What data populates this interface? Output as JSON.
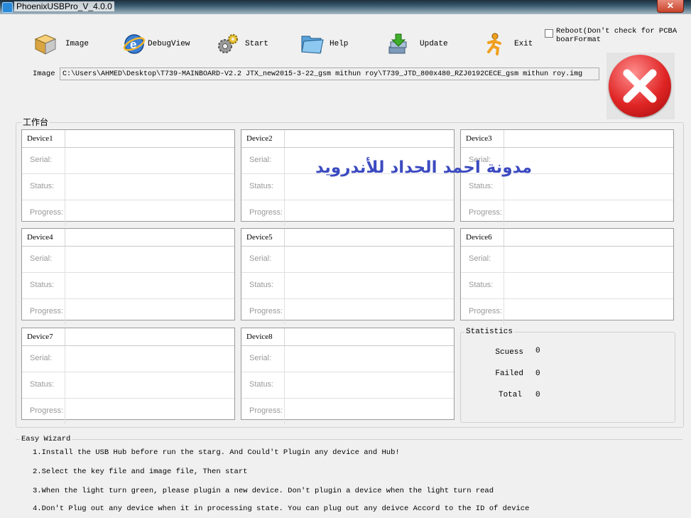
{
  "window": {
    "title": "PhoenixUSBPro_V_4.0.0",
    "close_label": "✕"
  },
  "toolbar": {
    "image": "Image",
    "debugview": "DebugView",
    "start": "Start",
    "help": "Help",
    "update": "Update",
    "exit": "Exit"
  },
  "options": {
    "reboot_label": "Reboot(Don't check for PCBA boarFormat",
    "reboot_checked": false
  },
  "image_row": {
    "label": "Image",
    "path": "C:\\Users\\AHMED\\Desktop\\T739-MAINBOARD-V2.2 JTX_new2015-3-22_gsm mithun roy\\T739_JTD_800x480_RZJ0192CECE_gsm mithun roy.img"
  },
  "workbench": {
    "label": "工作台"
  },
  "field_labels": {
    "serial": "Serial:",
    "status": "Status:",
    "progress": "Progress:"
  },
  "devices": [
    {
      "name": "Device1"
    },
    {
      "name": "Device2"
    },
    {
      "name": "Device3"
    },
    {
      "name": "Device4"
    },
    {
      "name": "Device5"
    },
    {
      "name": "Device6"
    },
    {
      "name": "Device7"
    },
    {
      "name": "Device8"
    }
  ],
  "statistics": {
    "label": "Statistics",
    "success_label": "Scuess",
    "success_value": "0",
    "failed_label": "Failed",
    "failed_value": "0",
    "total_label": "Total",
    "total_value": "0"
  },
  "watermark": "مدونة احمد الحداد للأندرويد",
  "wizard": {
    "label": "Easy Wizard",
    "steps": [
      "1.Install the USB Hub before run the starg. And Could't Plugin any device and Hub!",
      "2.Select the key file and image file, Then start",
      "3.When the light turn green, please plugin a new device. Don't plugin a device when the light turn read",
      "4.Don't Plug out any device when it in processing state. You can plug out any deivce Accord to the ID of device"
    ]
  },
  "icons": {
    "app": "app-icon",
    "image": "box-icon",
    "debugview": "ie-icon",
    "start": "gears-icon",
    "help": "folder-icon",
    "update": "download-icon",
    "exit": "running-man-icon",
    "stop": "red-x-icon"
  },
  "colors": {
    "stop_red": "#e02525",
    "watermark": "#3c4bc0",
    "update_green": "#3fae2b"
  }
}
